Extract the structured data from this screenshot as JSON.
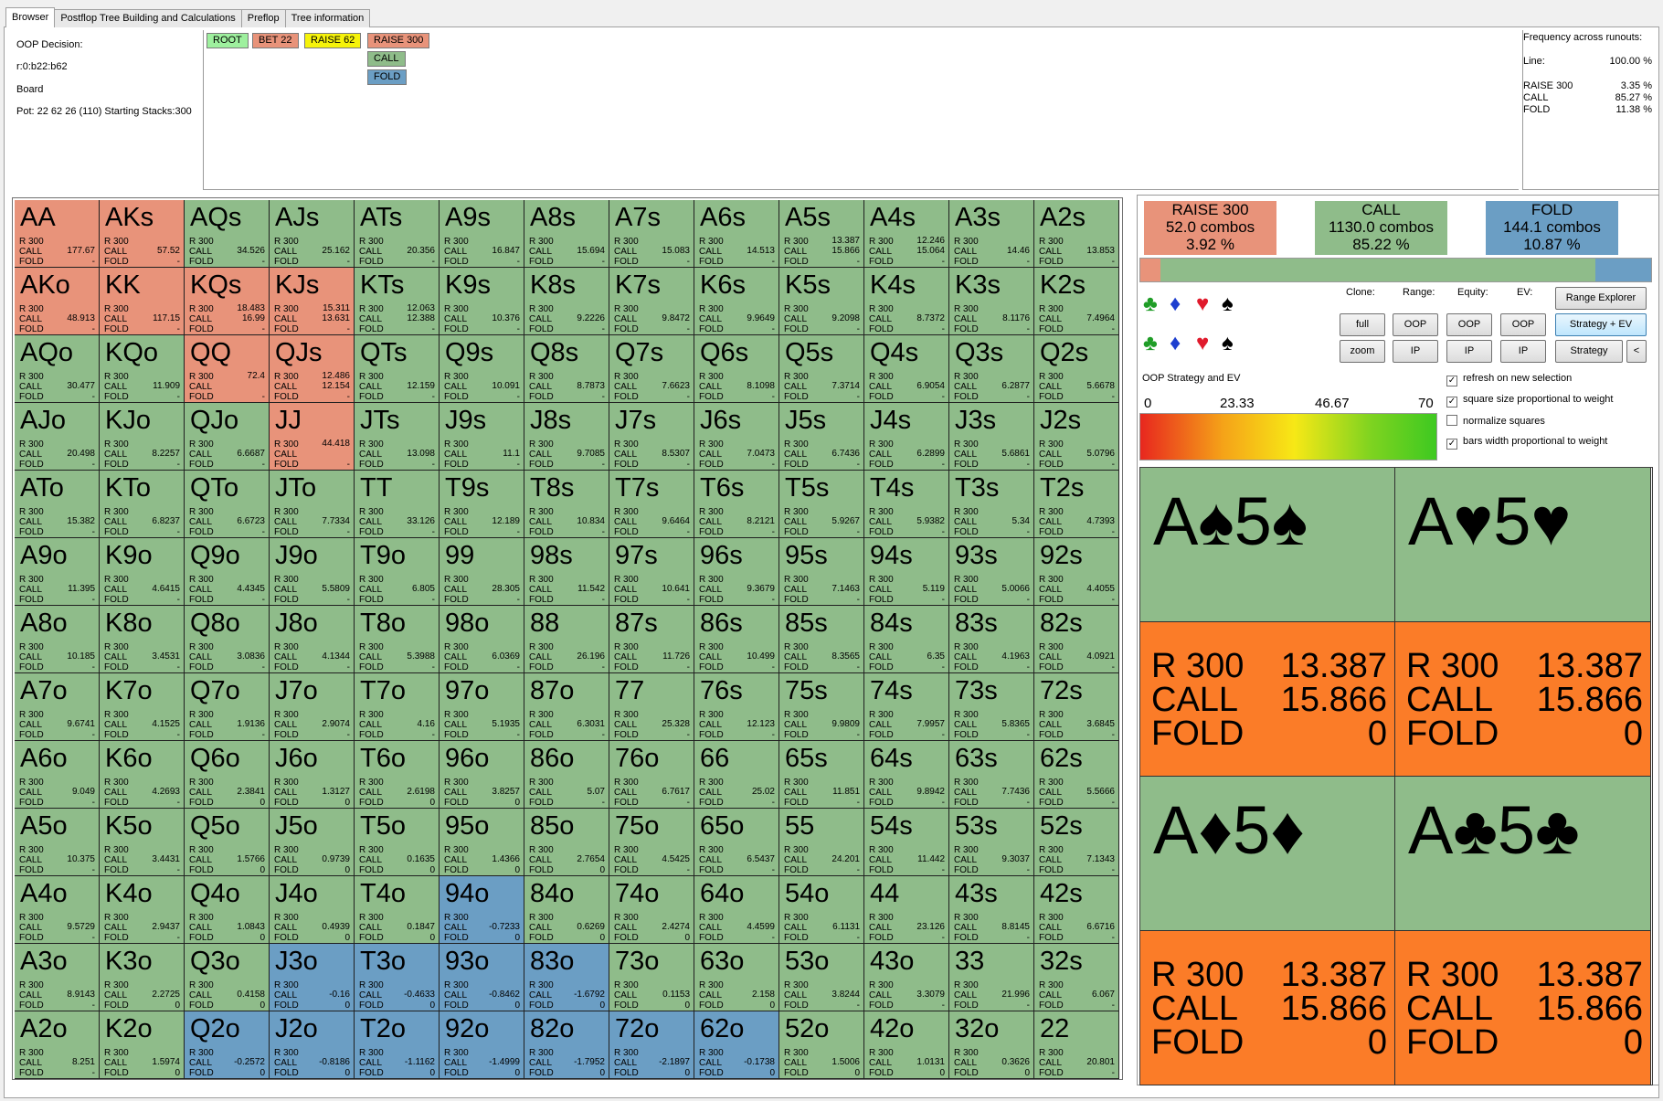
{
  "tabs": [
    "Browser",
    "Postflop Tree Building and Calculations",
    "Preflop",
    "Tree information"
  ],
  "info": {
    "decision": "OOP Decision:",
    "line": "r:0:b22:b62",
    "board": "Board",
    "pot": "Pot: 22 62 26 (110) Starting Stacks:300"
  },
  "tree": {
    "root": "ROOT",
    "bet": "BET 22",
    "raise62": "RAISE 62",
    "raise300": "RAISE 300",
    "call": "CALL",
    "fold": "FOLD"
  },
  "freq": {
    "title": "Frequency across runouts:",
    "line_label": "Line:",
    "line_value": "100.00 %",
    "raise_label": "RAISE 300",
    "raise_value": "3.35 %",
    "call_label": "CALL",
    "call_value": "85.27 %",
    "fold_label": "FOLD",
    "fold_value": "11.38 %"
  },
  "colors": {
    "raise": "#e8937a",
    "call": "#8fbc8a",
    "fold": "#6b9ec4",
    "combo_strategy": "#fb7c28"
  },
  "grid": {
    "action_labels": [
      "R 300",
      "CALL",
      "FOLD"
    ],
    "hands": [
      {
        "h": "AA",
        "c": "r",
        "ev": "177.67",
        "f": "-"
      },
      {
        "h": "AKs",
        "c": "r",
        "ev": "57.52",
        "f": "-"
      },
      {
        "h": "AQs",
        "c": "g",
        "ev": "34.526",
        "f": "-"
      },
      {
        "h": "AJs",
        "c": "g",
        "ev": "25.162",
        "f": "-"
      },
      {
        "h": "ATs",
        "c": "g",
        "ev": "20.356",
        "f": "-"
      },
      {
        "h": "A9s",
        "c": "g",
        "ev": "16.847",
        "f": "-"
      },
      {
        "h": "A8s",
        "c": "g",
        "ev": "15.694",
        "f": "-"
      },
      {
        "h": "A7s",
        "c": "g",
        "ev": "15.083",
        "f": "-"
      },
      {
        "h": "A6s",
        "c": "g",
        "ev": "14.513",
        "f": "-"
      },
      {
        "h": "A5s",
        "c": "g",
        "rv": "13.387",
        "ev": "15.866",
        "f": "-"
      },
      {
        "h": "A4s",
        "c": "g",
        "rv": "12.246",
        "ev": "15.064",
        "f": "-"
      },
      {
        "h": "A3s",
        "c": "g",
        "ev": "14.46",
        "f": "-"
      },
      {
        "h": "A2s",
        "c": "g",
        "ev": "13.853",
        "f": "-"
      },
      {
        "h": "AKo",
        "c": "r",
        "ev": "48.913",
        "f": "-"
      },
      {
        "h": "KK",
        "c": "r",
        "ev": "117.15",
        "f": "-"
      },
      {
        "h": "KQs",
        "c": "r",
        "rv": "18.483",
        "ev": "16.99",
        "f": "-"
      },
      {
        "h": "KJs",
        "c": "r",
        "rv": "15.311",
        "ev": "13.631",
        "f": "-"
      },
      {
        "h": "KTs",
        "c": "g",
        "rv": "12.063",
        "ev": "12.388",
        "f": "-"
      },
      {
        "h": "K9s",
        "c": "g",
        "ev": "10.376",
        "f": "-"
      },
      {
        "h": "K8s",
        "c": "g",
        "ev": "9.2226",
        "f": "-"
      },
      {
        "h": "K7s",
        "c": "g",
        "ev": "9.8472",
        "f": "-"
      },
      {
        "h": "K6s",
        "c": "g",
        "ev": "9.9649",
        "f": "-"
      },
      {
        "h": "K5s",
        "c": "g",
        "ev": "9.2098",
        "f": "-"
      },
      {
        "h": "K4s",
        "c": "g",
        "ev": "8.7372",
        "f": "-"
      },
      {
        "h": "K3s",
        "c": "g",
        "ev": "8.1176",
        "f": "-"
      },
      {
        "h": "K2s",
        "c": "g",
        "ev": "7.4964",
        "f": "-"
      },
      {
        "h": "AQo",
        "c": "g",
        "ev": "30.477",
        "f": "-"
      },
      {
        "h": "KQo",
        "c": "g",
        "ev": "11.909",
        "f": "-"
      },
      {
        "h": "QQ",
        "c": "r",
        "rv": "72.4",
        "ev": "",
        "f": "-"
      },
      {
        "h": "QJs",
        "c": "r",
        "rv": "12.486",
        "ev": "12.154",
        "f": "-"
      },
      {
        "h": "QTs",
        "c": "g",
        "ev": "12.159",
        "f": "-"
      },
      {
        "h": "Q9s",
        "c": "g",
        "ev": "10.091",
        "f": "-"
      },
      {
        "h": "Q8s",
        "c": "g",
        "ev": "8.7873",
        "f": "-"
      },
      {
        "h": "Q7s",
        "c": "g",
        "ev": "7.6623",
        "f": "-"
      },
      {
        "h": "Q6s",
        "c": "g",
        "ev": "8.1098",
        "f": "-"
      },
      {
        "h": "Q5s",
        "c": "g",
        "ev": "7.3714",
        "f": "-"
      },
      {
        "h": "Q4s",
        "c": "g",
        "ev": "6.9054",
        "f": "-"
      },
      {
        "h": "Q3s",
        "c": "g",
        "ev": "6.2877",
        "f": "-"
      },
      {
        "h": "Q2s",
        "c": "g",
        "ev": "5.6678",
        "f": "-"
      },
      {
        "h": "AJo",
        "c": "g",
        "ev": "20.498",
        "f": "-"
      },
      {
        "h": "KJo",
        "c": "g",
        "ev": "8.2257",
        "f": "-"
      },
      {
        "h": "QJo",
        "c": "g",
        "ev": "6.6687",
        "f": "-"
      },
      {
        "h": "JJ",
        "c": "r",
        "rv": "44.418",
        "ev": "",
        "f": "-"
      },
      {
        "h": "JTs",
        "c": "g",
        "ev": "13.098",
        "f": "-"
      },
      {
        "h": "J9s",
        "c": "g",
        "ev": "11.1",
        "f": "-"
      },
      {
        "h": "J8s",
        "c": "g",
        "ev": "9.7085",
        "f": "-"
      },
      {
        "h": "J7s",
        "c": "g",
        "ev": "8.5307",
        "f": "-"
      },
      {
        "h": "J6s",
        "c": "g",
        "ev": "7.0473",
        "f": "-"
      },
      {
        "h": "J5s",
        "c": "g",
        "ev": "6.7436",
        "f": "-"
      },
      {
        "h": "J4s",
        "c": "g",
        "ev": "6.2899",
        "f": "-"
      },
      {
        "h": "J3s",
        "c": "g",
        "ev": "5.6861",
        "f": "-"
      },
      {
        "h": "J2s",
        "c": "g",
        "ev": "5.0796",
        "f": "-"
      },
      {
        "h": "ATo",
        "c": "g",
        "ev": "15.382",
        "f": "-"
      },
      {
        "h": "KTo",
        "c": "g",
        "ev": "6.8237",
        "f": "-"
      },
      {
        "h": "QTo",
        "c": "g",
        "ev": "6.6723",
        "f": "-"
      },
      {
        "h": "JTo",
        "c": "g",
        "ev": "7.7334",
        "f": "-"
      },
      {
        "h": "TT",
        "c": "g",
        "ev": "33.126",
        "f": "-"
      },
      {
        "h": "T9s",
        "c": "g",
        "ev": "12.189",
        "f": "-"
      },
      {
        "h": "T8s",
        "c": "g",
        "ev": "10.834",
        "f": "-"
      },
      {
        "h": "T7s",
        "c": "g",
        "ev": "9.6464",
        "f": "-"
      },
      {
        "h": "T6s",
        "c": "g",
        "ev": "8.2121",
        "f": "-"
      },
      {
        "h": "T5s",
        "c": "g",
        "ev": "5.9267",
        "f": "-"
      },
      {
        "h": "T4s",
        "c": "g",
        "ev": "5.9382",
        "f": "-"
      },
      {
        "h": "T3s",
        "c": "g",
        "ev": "5.34",
        "f": "-"
      },
      {
        "h": "T2s",
        "c": "g",
        "ev": "4.7393",
        "f": "-"
      },
      {
        "h": "A9o",
        "c": "g",
        "ev": "11.395",
        "f": "-"
      },
      {
        "h": "K9o",
        "c": "g",
        "ev": "4.6415",
        "f": "-"
      },
      {
        "h": "Q9o",
        "c": "g",
        "ev": "4.4345",
        "f": "-"
      },
      {
        "h": "J9o",
        "c": "g",
        "ev": "5.5809",
        "f": "-"
      },
      {
        "h": "T9o",
        "c": "g",
        "ev": "6.805",
        "f": "-"
      },
      {
        "h": "99",
        "c": "g",
        "ev": "28.305",
        "f": "-"
      },
      {
        "h": "98s",
        "c": "g",
        "ev": "11.542",
        "f": "-"
      },
      {
        "h": "97s",
        "c": "g",
        "ev": "10.641",
        "f": "-"
      },
      {
        "h": "96s",
        "c": "g",
        "ev": "9.3679",
        "f": "-"
      },
      {
        "h": "95s",
        "c": "g",
        "ev": "7.1463",
        "f": "-"
      },
      {
        "h": "94s",
        "c": "g",
        "ev": "5.119",
        "f": "-"
      },
      {
        "h": "93s",
        "c": "g",
        "ev": "5.0066",
        "f": "-"
      },
      {
        "h": "92s",
        "c": "g",
        "ev": "4.4055",
        "f": "-"
      },
      {
        "h": "A8o",
        "c": "g",
        "ev": "10.185",
        "f": "-"
      },
      {
        "h": "K8o",
        "c": "g",
        "ev": "3.4531",
        "f": "-"
      },
      {
        "h": "Q8o",
        "c": "g",
        "ev": "3.0836",
        "f": "-"
      },
      {
        "h": "J8o",
        "c": "g",
        "ev": "4.1344",
        "f": "-"
      },
      {
        "h": "T8o",
        "c": "g",
        "ev": "5.3988",
        "f": "-"
      },
      {
        "h": "98o",
        "c": "g",
        "ev": "6.0369",
        "f": "-"
      },
      {
        "h": "88",
        "c": "g",
        "ev": "26.196",
        "f": "-"
      },
      {
        "h": "87s",
        "c": "g",
        "ev": "11.726",
        "f": "-"
      },
      {
        "h": "86s",
        "c": "g",
        "ev": "10.499",
        "f": "-"
      },
      {
        "h": "85s",
        "c": "g",
        "ev": "8.3565",
        "f": "-"
      },
      {
        "h": "84s",
        "c": "g",
        "ev": "6.35",
        "f": "-"
      },
      {
        "h": "83s",
        "c": "g",
        "ev": "4.1963",
        "f": "-"
      },
      {
        "h": "82s",
        "c": "g",
        "ev": "4.0921",
        "f": "-"
      },
      {
        "h": "A7o",
        "c": "g",
        "ev": "9.6741",
        "f": "-"
      },
      {
        "h": "K7o",
        "c": "g",
        "ev": "4.1525",
        "f": "-"
      },
      {
        "h": "Q7o",
        "c": "g",
        "ev": "1.9136",
        "f": "-"
      },
      {
        "h": "J7o",
        "c": "g",
        "ev": "2.9074",
        "f": "-"
      },
      {
        "h": "T7o",
        "c": "g",
        "ev": "4.16",
        "f": "-"
      },
      {
        "h": "97o",
        "c": "g",
        "ev": "5.1935",
        "f": "-"
      },
      {
        "h": "87o",
        "c": "g",
        "ev": "6.3031",
        "f": "-"
      },
      {
        "h": "77",
        "c": "g",
        "ev": "25.328",
        "f": "-"
      },
      {
        "h": "76s",
        "c": "g",
        "ev": "12.123",
        "f": "-"
      },
      {
        "h": "75s",
        "c": "g",
        "ev": "9.9809",
        "f": "-"
      },
      {
        "h": "74s",
        "c": "g",
        "ev": "7.9957",
        "f": "-"
      },
      {
        "h": "73s",
        "c": "g",
        "ev": "5.8365",
        "f": "-"
      },
      {
        "h": "72s",
        "c": "g",
        "ev": "3.6845",
        "f": "-"
      },
      {
        "h": "A6o",
        "c": "g",
        "ev": "9.049",
        "f": "-"
      },
      {
        "h": "K6o",
        "c": "g",
        "ev": "4.2693",
        "f": "-"
      },
      {
        "h": "Q6o",
        "c": "g",
        "ev": "2.3841",
        "f": "0"
      },
      {
        "h": "J6o",
        "c": "g",
        "ev": "1.3127",
        "f": "0"
      },
      {
        "h": "T6o",
        "c": "g",
        "ev": "2.6198",
        "f": "0"
      },
      {
        "h": "96o",
        "c": "g",
        "ev": "3.8257",
        "f": "0"
      },
      {
        "h": "86o",
        "c": "g",
        "ev": "5.07",
        "f": "-"
      },
      {
        "h": "76o",
        "c": "g",
        "ev": "6.7617",
        "f": "-"
      },
      {
        "h": "66",
        "c": "g",
        "ev": "25.02",
        "f": "-"
      },
      {
        "h": "65s",
        "c": "g",
        "ev": "11.851",
        "f": "-"
      },
      {
        "h": "64s",
        "c": "g",
        "ev": "9.8942",
        "f": "-"
      },
      {
        "h": "63s",
        "c": "g",
        "ev": "7.7436",
        "f": "-"
      },
      {
        "h": "62s",
        "c": "g",
        "ev": "5.5666",
        "f": "-"
      },
      {
        "h": "A5o",
        "c": "g",
        "ev": "10.375",
        "f": "-"
      },
      {
        "h": "K5o",
        "c": "g",
        "ev": "3.4431",
        "f": "-"
      },
      {
        "h": "Q5o",
        "c": "g",
        "ev": "1.5766",
        "f": "0"
      },
      {
        "h": "J5o",
        "c": "g",
        "ev": "0.9739",
        "f": "0"
      },
      {
        "h": "T5o",
        "c": "g",
        "ev": "0.1635",
        "f": "0"
      },
      {
        "h": "95o",
        "c": "g",
        "ev": "1.4366",
        "f": "0"
      },
      {
        "h": "85o",
        "c": "g",
        "ev": "2.7654",
        "f": "0"
      },
      {
        "h": "75o",
        "c": "g",
        "ev": "4.5425",
        "f": "-"
      },
      {
        "h": "65o",
        "c": "g",
        "ev": "6.5437",
        "f": "-"
      },
      {
        "h": "55",
        "c": "g",
        "ev": "24.201",
        "f": "-"
      },
      {
        "h": "54s",
        "c": "g",
        "ev": "11.442",
        "f": "-"
      },
      {
        "h": "53s",
        "c": "g",
        "ev": "9.3037",
        "f": "-"
      },
      {
        "h": "52s",
        "c": "g",
        "ev": "7.1343",
        "f": "-"
      },
      {
        "h": "A4o",
        "c": "g",
        "ev": "9.5729",
        "f": "-"
      },
      {
        "h": "K4o",
        "c": "g",
        "ev": "2.9437",
        "f": "-"
      },
      {
        "h": "Q4o",
        "c": "g",
        "ev": "1.0843",
        "f": "0"
      },
      {
        "h": "J4o",
        "c": "g",
        "ev": "0.4939",
        "f": "0"
      },
      {
        "h": "T4o",
        "c": "g",
        "ev": "0.1847",
        "f": "0"
      },
      {
        "h": "94o",
        "c": "b",
        "ev": "-0.7233",
        "f": "0"
      },
      {
        "h": "84o",
        "c": "g",
        "ev": "0.6269",
        "f": "0"
      },
      {
        "h": "74o",
        "c": "g",
        "ev": "2.4274",
        "f": "0"
      },
      {
        "h": "64o",
        "c": "g",
        "ev": "4.4599",
        "f": "-"
      },
      {
        "h": "54o",
        "c": "g",
        "ev": "6.1131",
        "f": "-"
      },
      {
        "h": "44",
        "c": "g",
        "ev": "23.126",
        "f": "-"
      },
      {
        "h": "43s",
        "c": "g",
        "ev": "8.8145",
        "f": "-"
      },
      {
        "h": "42s",
        "c": "g",
        "ev": "6.6716",
        "f": "-"
      },
      {
        "h": "A3o",
        "c": "g",
        "ev": "8.9143",
        "f": "-"
      },
      {
        "h": "K3o",
        "c": "g",
        "ev": "2.2725",
        "f": "0"
      },
      {
        "h": "Q3o",
        "c": "g",
        "ev": "0.4158",
        "f": "0"
      },
      {
        "h": "J3o",
        "c": "b",
        "ev": "-0.16",
        "f": "0"
      },
      {
        "h": "T3o",
        "c": "b",
        "ev": "-0.4633",
        "f": "0"
      },
      {
        "h": "93o",
        "c": "b",
        "ev": "-0.8462",
        "f": "0"
      },
      {
        "h": "83o",
        "c": "b",
        "ev": "-1.6792",
        "f": "0"
      },
      {
        "h": "73o",
        "c": "g",
        "ev": "0.1153",
        "f": "0"
      },
      {
        "h": "63o",
        "c": "g",
        "ev": "2.158",
        "f": "0"
      },
      {
        "h": "53o",
        "c": "g",
        "ev": "3.8244",
        "f": "-"
      },
      {
        "h": "43o",
        "c": "g",
        "ev": "3.3079",
        "f": "-"
      },
      {
        "h": "33",
        "c": "g",
        "ev": "21.996",
        "f": "-"
      },
      {
        "h": "32s",
        "c": "g",
        "ev": "6.067",
        "f": "-"
      },
      {
        "h": "A2o",
        "c": "g",
        "ev": "8.251",
        "f": "-"
      },
      {
        "h": "K2o",
        "c": "g",
        "ev": "1.5974",
        "f": "0"
      },
      {
        "h": "Q2o",
        "c": "b",
        "ev": "-0.2572",
        "f": "0"
      },
      {
        "h": "J2o",
        "c": "b",
        "ev": "-0.8186",
        "f": "0"
      },
      {
        "h": "T2o",
        "c": "b",
        "ev": "-1.1162",
        "f": "0"
      },
      {
        "h": "92o",
        "c": "b",
        "ev": "-1.4999",
        "f": "0"
      },
      {
        "h": "82o",
        "c": "b",
        "ev": "-1.7952",
        "f": "0"
      },
      {
        "h": "72o",
        "c": "b",
        "ev": "-2.1897",
        "f": "0"
      },
      {
        "h": "62o",
        "c": "b",
        "ev": "-0.1738",
        "f": "0"
      },
      {
        "h": "52o",
        "c": "g",
        "ev": "1.5006",
        "f": "0"
      },
      {
        "h": "42o",
        "c": "g",
        "ev": "1.0131",
        "f": "0"
      },
      {
        "h": "32o",
        "c": "g",
        "ev": "0.3626",
        "f": "0"
      },
      {
        "h": "22",
        "c": "g",
        "ev": "20.801",
        "f": "-"
      }
    ]
  },
  "summary": {
    "raise": {
      "title": "RAISE 300",
      "combos": "52.0 combos",
      "pct": "3.92 %",
      "fraction": 0.0392
    },
    "call": {
      "title": "CALL",
      "combos": "1130.0 combos",
      "pct": "85.22 %",
      "fraction": 0.8522
    },
    "fold": {
      "title": "FOLD",
      "combos": "144.1 combos",
      "pct": "10.87 %",
      "fraction": 0.1087
    }
  },
  "controls": {
    "clone_label": "Clone:",
    "range_label": "Range:",
    "equity_label": "Equity:",
    "ev_label": "EV:",
    "range_explorer": "Range Explorer",
    "full": "full",
    "zoom": "zoom",
    "oop": "OOP",
    "ip": "IP",
    "strategy_ev": "Strategy + EV",
    "strategy": "Strategy",
    "collapse": "<",
    "suits": [
      "♣",
      "♦",
      "♥",
      "♠"
    ]
  },
  "legend": {
    "title": "OOP Strategy and EV",
    "ticks": [
      "0",
      "23.33",
      "46.67",
      "70"
    ]
  },
  "checkboxes": [
    {
      "label": "refresh on new selection",
      "checked": true
    },
    {
      "label": "square size proportional to weight",
      "checked": true
    },
    {
      "label": "normalize squares",
      "checked": false
    },
    {
      "label": "bars width proportional to weight",
      "checked": true
    }
  ],
  "combos": [
    {
      "name": "A♠5♠",
      "r": "13.387",
      "c": "15.866",
      "f": "0"
    },
    {
      "name": "A♥5♥",
      "r": "13.387",
      "c": "15.866",
      "f": "0"
    },
    {
      "name": "A♦5♦",
      "r": "13.387",
      "c": "15.866",
      "f": "0"
    },
    {
      "name": "A♣5♣",
      "r": "13.387",
      "c": "15.866",
      "f": "0"
    }
  ],
  "combo_labels": {
    "r": "R 300",
    "c": "CALL",
    "f": "FOLD"
  }
}
